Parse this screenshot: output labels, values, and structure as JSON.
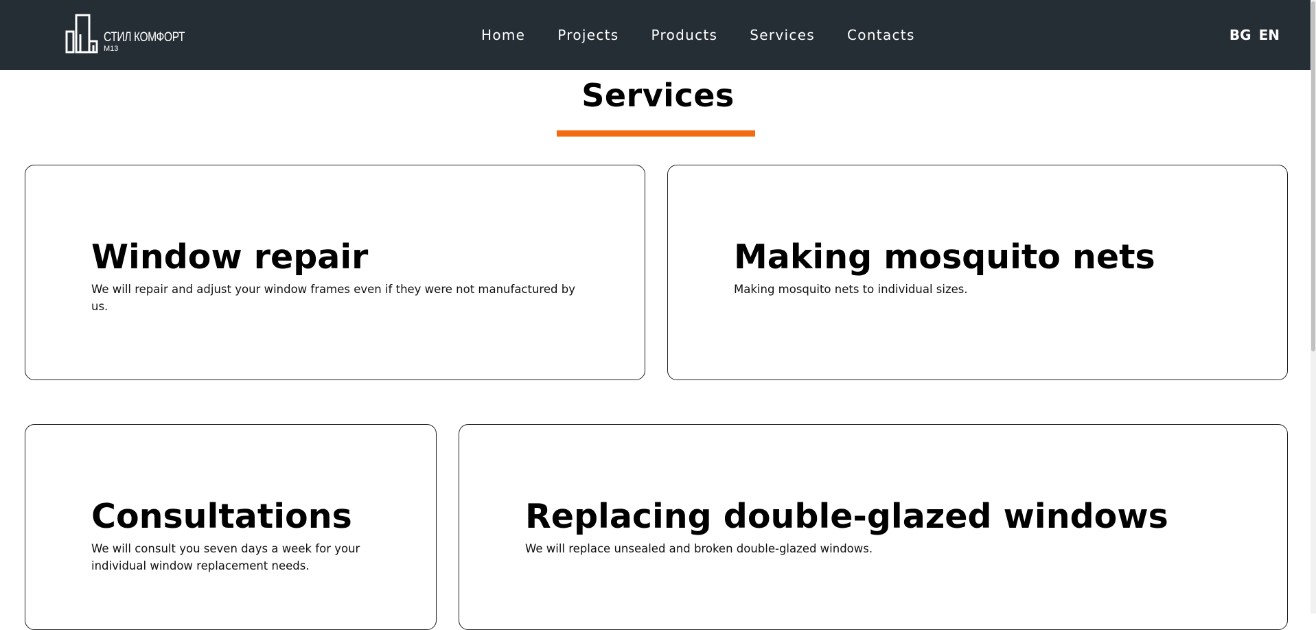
{
  "header": {
    "logo_name": "СТИЛ КОМФОРТ",
    "logo_sub": "М13",
    "nav": [
      {
        "label": "Home"
      },
      {
        "label": "Projects"
      },
      {
        "label": "Products"
      },
      {
        "label": "Services"
      },
      {
        "label": "Contacts"
      }
    ],
    "languages": [
      "BG",
      "EN"
    ]
  },
  "main": {
    "section_title": "Services",
    "accent_color": "#f36a10",
    "services": [
      {
        "title": "Window repair",
        "description": "We will repair and adjust your window frames even if they were not manufactured by us."
      },
      {
        "title": "Making mosquito nets",
        "description": "Making mosquito nets to individual sizes."
      },
      {
        "title": "Consultations",
        "description": "We will consult you seven days a week for your individual window replacement needs."
      },
      {
        "title": "Replacing double-glazed windows",
        "description": "We will replace unsealed and broken double-glazed windows."
      }
    ]
  },
  "colors": {
    "navbar_bg": "#252d35",
    "text": "#000000",
    "card_border": "#1f1f1f"
  }
}
